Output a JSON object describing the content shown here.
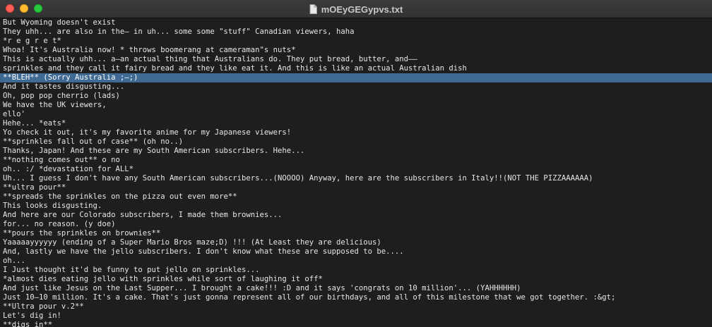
{
  "window": {
    "title": "mOEyGEGypvs.txt",
    "icon": "document-icon",
    "accent_selection_color": "#3e6a93"
  },
  "lines": [
    "But Wyoming doesn't exist",
    "They uhh... are also in the— in uh... some some \"stuff\" Canadian viewers, haha",
    "*r e g r e t*",
    "Whoa! It's Australia now! * throws boomerang at cameraman\"s nuts*",
    "This is actually uhh... a—an actual thing that Australians do. They put bread, butter, and——",
    "sprinkles and they call it fairy bread and they like eat it. And this is like an actual Australian dish",
    "**BLEH** (Sorry Australia ;—;)",
    "And it tastes disgusting...",
    "Oh, pop pop cherrio (lads)",
    "We have the UK viewers,",
    "ello'",
    "Hehe... *eats*",
    "Yo check it out, it's my favorite anime for my Japanese viewers!",
    "**sprinkles fall out of case** (oh no..)",
    "Thanks, Japan! And these are my South American subscribers. Hehe...",
    "**nothing comes out** o no",
    "oh.. :/ *devastation for ALL*",
    "Uh... I guess I don't have any South American subscribers...(NOOOO) Anyway, here are the subscribers in Italy!!(NOT THE PIZZAAAAAA)",
    "**ultra pour**",
    "**spreads the sprinkles on the pizza out even more**",
    "This looks disgusting.",
    "And here are our Colorado subscribers, I made them brownies...",
    "for... no reason. (y doe)",
    "**pours the sprinkles on brownies**",
    "Yaaaaayyyyyy (ending of a Super Mario Bros maze;D) !!! (At Least they are delicious)",
    "And, lastly we have the jello subscribers. I don't know what these are supposed to be....",
    "oh...",
    "I Just thought it'd be funny to put jello on sprinkles...",
    "*almost dies eating jello with sprinkles while sort of laughing it off*",
    "And just like Jesus on the Last Supper... I brought a cake!!! :D and it says 'congrats on 10 million'... (YAHHHHHH)",
    "Just 10—10 million. It's a cake. That's just gonna represent all of our birthdays, and all of this milestone that we got together. :&gt;",
    "**Ultra pour v.2**",
    "Let's dig in!",
    "**digs in**"
  ],
  "selected_line": "**BLEH** (Sorry Australia ;—;)"
}
